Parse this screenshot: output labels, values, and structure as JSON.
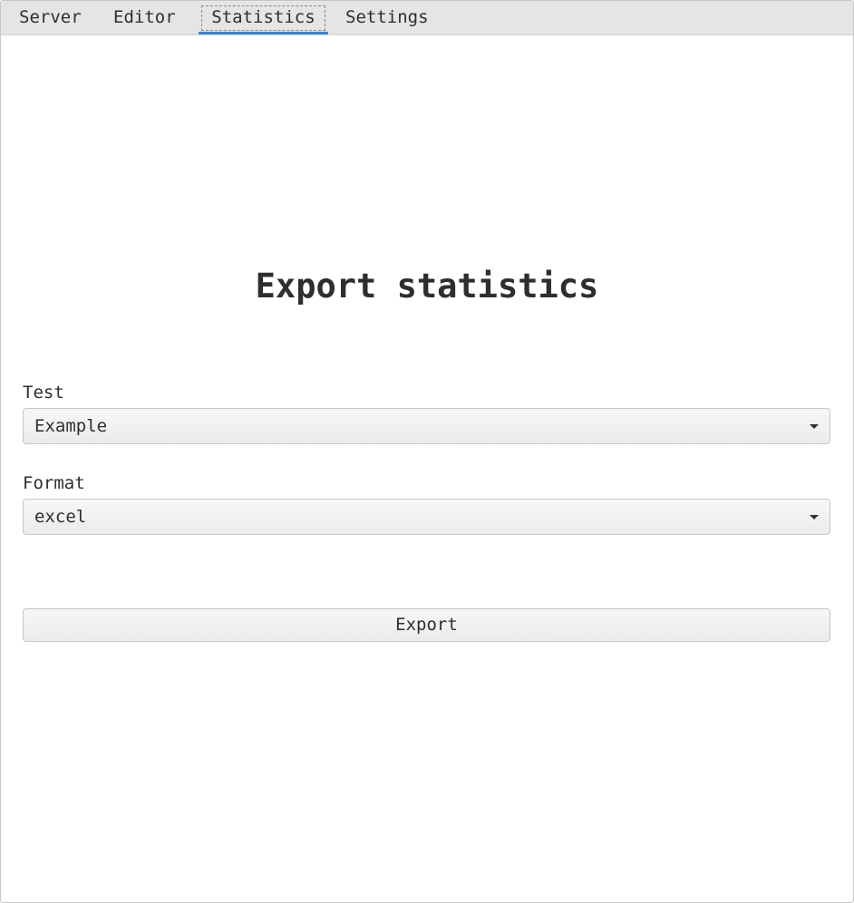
{
  "tabs": [
    {
      "label": "Server"
    },
    {
      "label": "Editor"
    },
    {
      "label": "Statistics",
      "active": true
    },
    {
      "label": "Settings"
    }
  ],
  "main": {
    "title": "Export statistics",
    "test_field": {
      "label": "Test",
      "selected": "Example"
    },
    "format_field": {
      "label": "Format",
      "selected": "excel"
    },
    "export_button": {
      "label": "Export"
    }
  },
  "colors": {
    "accent": "#3584e4",
    "tabbar_bg": "#e6e5e3",
    "text": "#2e2e2e"
  },
  "icons": {
    "dropdown": "chevron-down-icon"
  }
}
